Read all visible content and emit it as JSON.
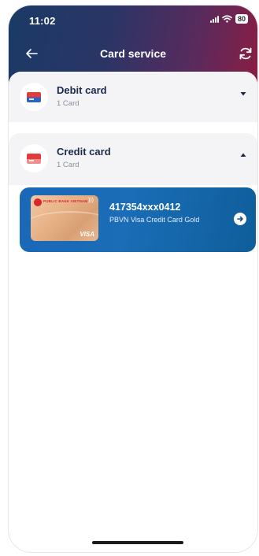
{
  "status_bar": {
    "time": "11:02",
    "battery": "80"
  },
  "header": {
    "title": "Card service",
    "back_icon": "arrow-left-icon",
    "refresh_icon": "refresh-icon"
  },
  "groups": [
    {
      "title": "Debit card",
      "subtitle": "1 Card",
      "expanded": false,
      "icon": "debit-card-icon"
    },
    {
      "title": "Credit card",
      "subtitle": "1 Card",
      "expanded": true,
      "icon": "credit-card-icon"
    }
  ],
  "credit_cards": [
    {
      "number": "417354xxx0412",
      "name": "PBVN Visa Credit Card Gold",
      "issuer": "PUBLIC BANK VIETNAM",
      "network": "VISA"
    }
  ],
  "colors": {
    "header_start": "#1b3a66",
    "header_end": "#8a1d43",
    "card_row": "#1a68b8",
    "title_text": "#1b2a4a"
  }
}
